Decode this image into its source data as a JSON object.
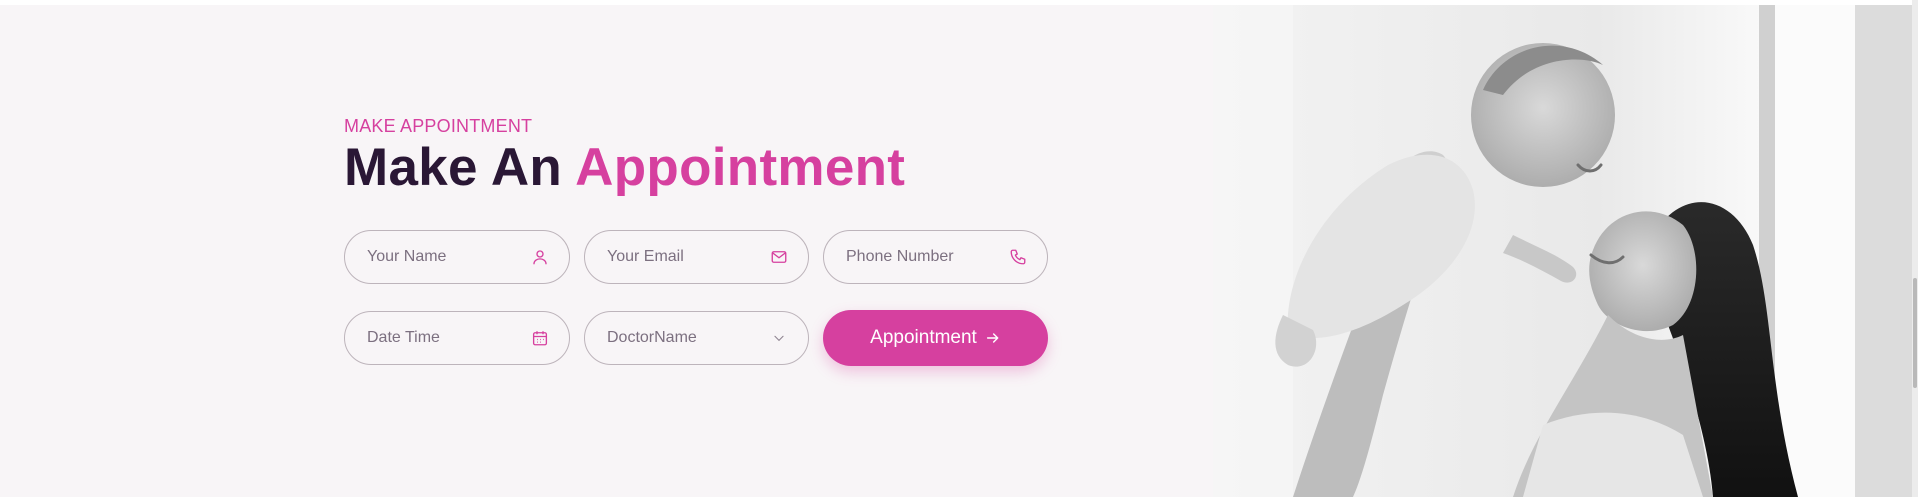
{
  "section": {
    "eyebrow": "MAKE APPOINTMENT",
    "title_main": "Make An",
    "title_accent": "Appointment"
  },
  "form": {
    "name_placeholder": "Your Name",
    "email_placeholder": "Your Email",
    "phone_placeholder": "Phone Number",
    "datetime_placeholder": "Date Time",
    "doctor_selected": "DoctorName",
    "submit_label": "Appointment",
    "icons": {
      "name": "user-icon",
      "email": "mail-icon",
      "phone": "phone-icon",
      "datetime": "calendar-icon",
      "doctor": "chevron-down-icon",
      "submit": "arrow-right-icon"
    }
  },
  "image": {
    "subject": "mother-lifting-baby-photo"
  },
  "colors": {
    "accent": "#d6409f",
    "heading": "#2a1735",
    "background": "#f8f5f7"
  }
}
